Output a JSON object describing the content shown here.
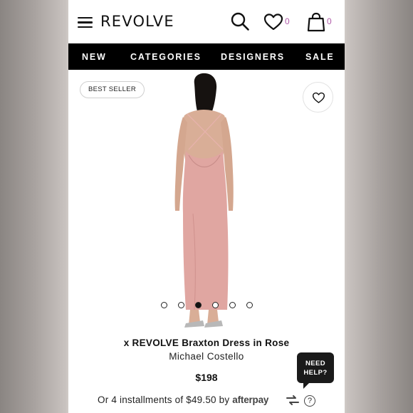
{
  "header": {
    "brand": "REVOLVE",
    "wishlist_count": "0",
    "bag_count": "0"
  },
  "nav": {
    "items": [
      "NEW",
      "CATEGORIES",
      "DESIGNERS",
      "SALE"
    ]
  },
  "product": {
    "badge": "BEST SELLER",
    "title": "x REVOLVE Braxton Dress in Rose",
    "designer": "Michael Costello",
    "price": "$198",
    "installments_text": "Or 4 installments of $49.50 by",
    "afterpay_label": "afterpay",
    "help_symbol": "?",
    "image_count": 6,
    "active_image": 3,
    "dress_color": "#e0a6a1"
  },
  "help": {
    "line1": "NEED",
    "line2": "HELP?"
  },
  "colors": {
    "nav_bg": "#000000",
    "count_color": "#b05aa8"
  }
}
